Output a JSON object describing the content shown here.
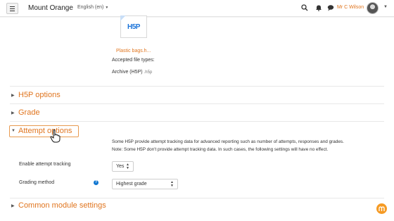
{
  "navbar": {
    "site_name": "Mount Orange",
    "language": "English (en)",
    "user_name": "Mr C Wilson",
    "icons": [
      "menu-icon",
      "search-icon",
      "bell-icon",
      "chat-icon",
      "avatar",
      "caret-down-icon"
    ]
  },
  "file": {
    "logo_text": "H5P",
    "name": "Plastic bags.h..."
  },
  "accepted": {
    "label": "Accepted file types:",
    "value": "Archive (H5P)",
    "ext": ".h5p"
  },
  "sections": {
    "h5p_options": "H5P options",
    "grade": "Grade",
    "attempt_options": "Attempt options",
    "common_module": "Common module settings"
  },
  "attempt": {
    "line1": "Some H5P provide attempt tracking data for advanced reporting such as number of attempts, responses and grades.",
    "line2": "Note: Some H5P don't provide attempt tracking data. In such cases, the following settings will have no effect.",
    "tracking_label": "Enable attempt tracking",
    "tracking_value": "Yes",
    "grading_label": "Grading method",
    "grading_value": "Highest grade"
  },
  "colors": {
    "accent": "#e0751f",
    "help": "#1177d1",
    "fab": "#f59a23"
  }
}
